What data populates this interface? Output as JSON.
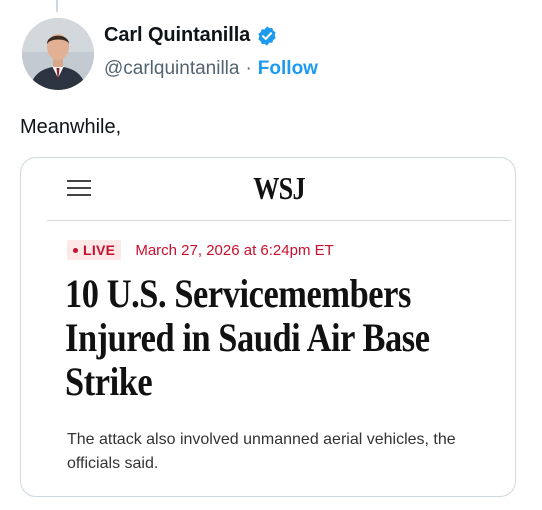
{
  "tweet": {
    "author": {
      "display_name": "Carl Quintanilla",
      "handle": "@carlquintanilla",
      "separator": "·",
      "follow_label": "Follow"
    },
    "text": "Meanwhile,"
  },
  "card": {
    "publication": "WSJ",
    "live_label": "LIVE",
    "timestamp": "March 27, 2026 at 6:24pm ET",
    "headline": "10 U.S. Servicemembers Injured in Saudi Air Base Strike",
    "subhead": "The attack also involved unmanned aerial vehicles, the officials said."
  },
  "colors": {
    "accent": "#1d9bf0",
    "live_red": "#c8102e",
    "live_bg": "#fde8e8",
    "secondary_text": "#536471"
  },
  "icons": [
    "verified-badge-icon",
    "hamburger-menu-icon"
  ]
}
